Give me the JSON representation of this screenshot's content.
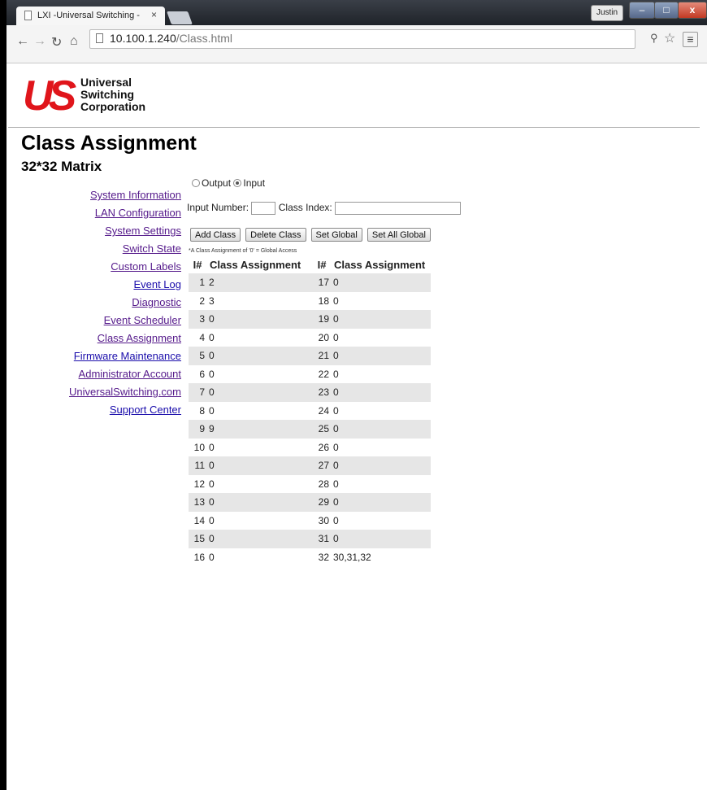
{
  "browser": {
    "tab_title": "LXI -Universal Switching - ",
    "tab_close": "×",
    "user_label": "Justin",
    "url_host": "10.100.1.240",
    "url_path": "/Class.html",
    "window_controls": {
      "minimize": "–",
      "maximize": "□",
      "close": "x"
    }
  },
  "logo": {
    "mark": "US",
    "line1": "Universal",
    "line2": "Switching",
    "line3": "Corporation"
  },
  "page": {
    "title": "Class Assignment",
    "subtitle": "32*32 Matrix"
  },
  "nav": [
    {
      "label": "System Information",
      "visited": true
    },
    {
      "label": "LAN Configuration",
      "visited": true
    },
    {
      "label": "System Settings",
      "visited": true
    },
    {
      "label": "Switch State",
      "visited": true
    },
    {
      "label": "Custom Labels",
      "visited": true
    },
    {
      "label": "Event Log",
      "visited": false
    },
    {
      "label": "Diagnostic",
      "visited": true
    },
    {
      "label": "Event Scheduler",
      "visited": true
    },
    {
      "label": "Class Assignment",
      "visited": true
    },
    {
      "label": "Firmware Maintenance",
      "visited": false
    },
    {
      "label": "Administrator Account",
      "visited": true
    },
    {
      "label": "UniversalSwitching.com",
      "visited": true
    },
    {
      "label": "Support Center",
      "visited": false
    }
  ],
  "form": {
    "radio_output": "Output",
    "radio_input": "Input",
    "selected": "Input",
    "input_number_label": "Input Number:",
    "input_number_value": "",
    "class_index_label": "Class Index:",
    "class_index_value": ""
  },
  "buttons": {
    "add": "Add Class",
    "delete": "Delete Class",
    "set_global": "Set Global",
    "set_all_global": "Set All Global"
  },
  "note": "*A Class Assignment of '0' = Global Access",
  "table": {
    "headers": [
      "I#",
      "Class Assignment",
      "I#",
      "Class Assignment"
    ],
    "rows": [
      [
        "1",
        "2",
        "17",
        "0"
      ],
      [
        "2",
        "3",
        "18",
        "0"
      ],
      [
        "3",
        "0",
        "19",
        "0"
      ],
      [
        "4",
        "0",
        "20",
        "0"
      ],
      [
        "5",
        "0",
        "21",
        "0"
      ],
      [
        "6",
        "0",
        "22",
        "0"
      ],
      [
        "7",
        "0",
        "23",
        "0"
      ],
      [
        "8",
        "0",
        "24",
        "0"
      ],
      [
        "9",
        "9",
        "25",
        "0"
      ],
      [
        "10",
        "0",
        "26",
        "0"
      ],
      [
        "11",
        "0",
        "27",
        "0"
      ],
      [
        "12",
        "0",
        "28",
        "0"
      ],
      [
        "13",
        "0",
        "29",
        "0"
      ],
      [
        "14",
        "0",
        "30",
        "0"
      ],
      [
        "15",
        "0",
        "31",
        "0"
      ],
      [
        "16",
        "0",
        "32",
        "30,31,32"
      ]
    ]
  }
}
